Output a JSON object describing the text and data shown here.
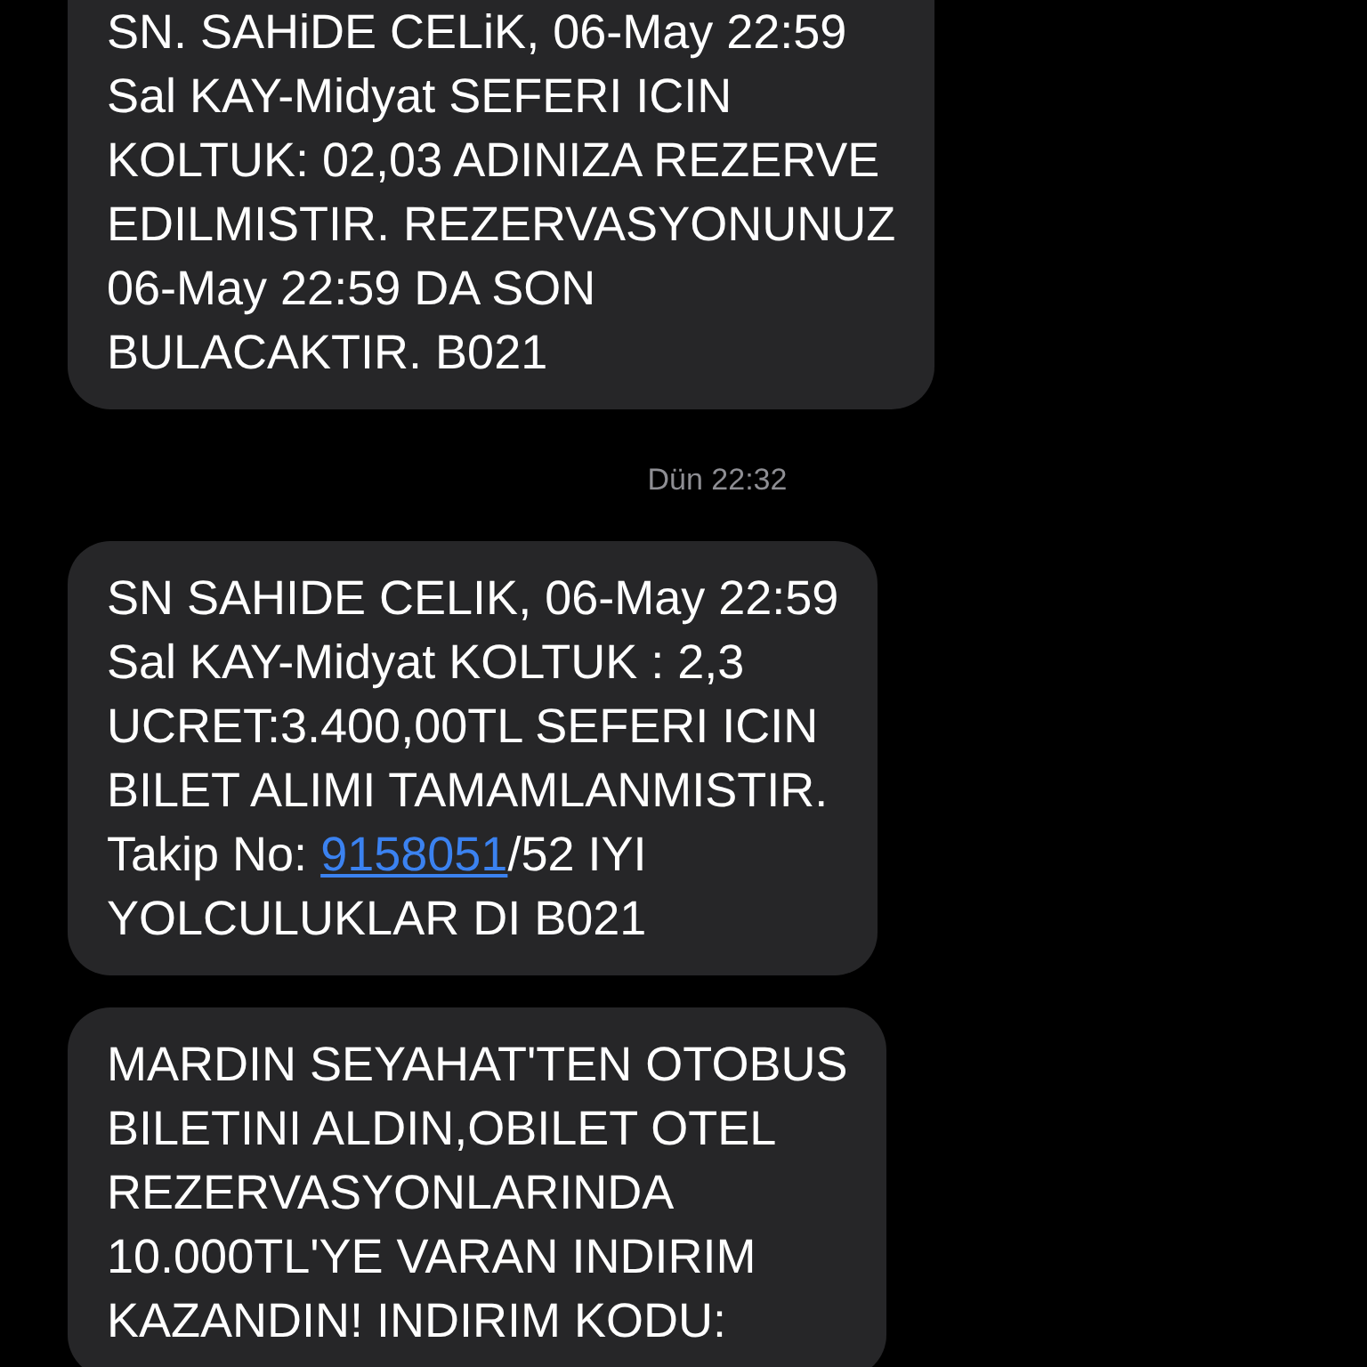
{
  "messages": [
    {
      "kind": "received",
      "text": "SN. SAHiDE CELiK, 06-May 22:59\nSal KAY-Midyat SEFERI ICIN\nKOLTUK: 02,03 ADINIZA REZERVE\nEDILMISTIR. REZERVASYONUNUZ\n06-May 22:59 DA SON\nBULACAKTIR. B021"
    },
    {
      "kind": "timestamp",
      "text": "Dün 22:32"
    },
    {
      "kind": "received",
      "text": "SN SAHIDE CELIK, 06-May 22:59\nSal KAY-Midyat KOLTUK : 2,3\nUCRET:3.400,00TL SEFERI ICIN\nBILET ALIMI TAMAMLANMISTIR.\nTakip No: ",
      "link": "9158051",
      "text_after": "/52 IYI\nYOLCULUKLAR DI B021"
    },
    {
      "kind": "received",
      "text": "MARDIN SEYAHAT'TEN OTOBUS\nBILETINI ALDIN,OBILET OTEL\nREZERVASYONLARINDA\n10.000TL'YE VARAN INDIRIM\nKAZANDIN! INDIRIM KODU:"
    }
  ]
}
